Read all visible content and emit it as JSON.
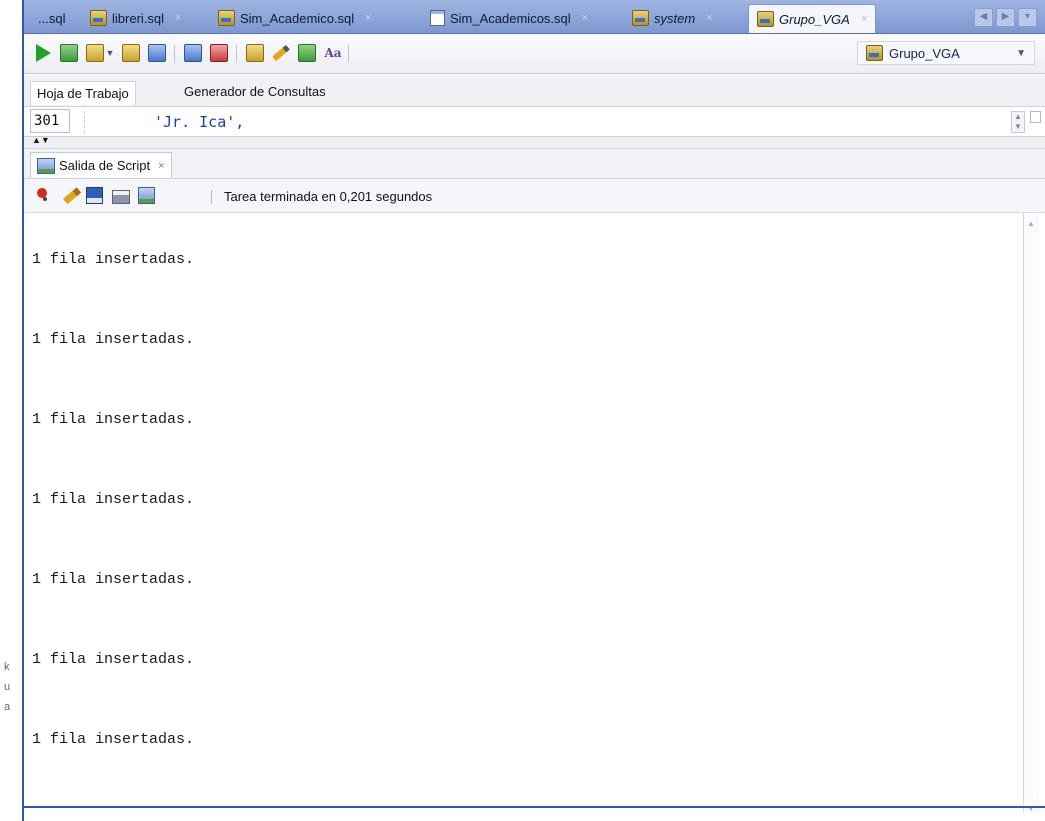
{
  "tabs": [
    {
      "label": "...sql",
      "icon": "none"
    },
    {
      "label": "libreri.sql",
      "icon": "sql-db-icon"
    },
    {
      "label": "Sim_Academico.sql",
      "icon": "sql-db-icon"
    },
    {
      "label": "Sim_Academicos.sql",
      "icon": "sheet-icon"
    },
    {
      "label": "system",
      "icon": "sql-db-icon"
    },
    {
      "label": "Grupo_VGA",
      "icon": "sql-db-icon",
      "active": true
    }
  ],
  "toolbar": {
    "connection_label": "Grupo_VGA",
    "buttons": [
      "run-statement-icon",
      "run-script-icon",
      "commit-icon",
      "rollback-icon",
      "autotrace-icon",
      "explain-plan-icon",
      "sql-tuning-icon",
      "unshared-worksheet-icon",
      "clear-icon",
      "history-icon",
      "format-icon"
    ]
  },
  "subtabs": {
    "worksheet": "Hoja de Trabajo",
    "query_builder": "Generador de Consultas"
  },
  "editor": {
    "line_number": "301",
    "code": "'Jr. Ica',"
  },
  "output": {
    "tab_label": "Salida de Script",
    "tab_close": "×",
    "status": "Tarea terminada en 0,201 segundos",
    "lines": [
      "1 fila insertadas.",
      "1 fila insertadas.",
      "1 fila insertadas.",
      "1 fila insertadas.",
      "1 fila insertadas.",
      "1 fila insertadas.",
      "1 fila insertadas."
    ]
  },
  "colors": {
    "window_border": "#3156b0",
    "tabbar_bg": "#8aa2d8",
    "code_blue": "#1a3cb8",
    "run_green": "#22a02a"
  }
}
